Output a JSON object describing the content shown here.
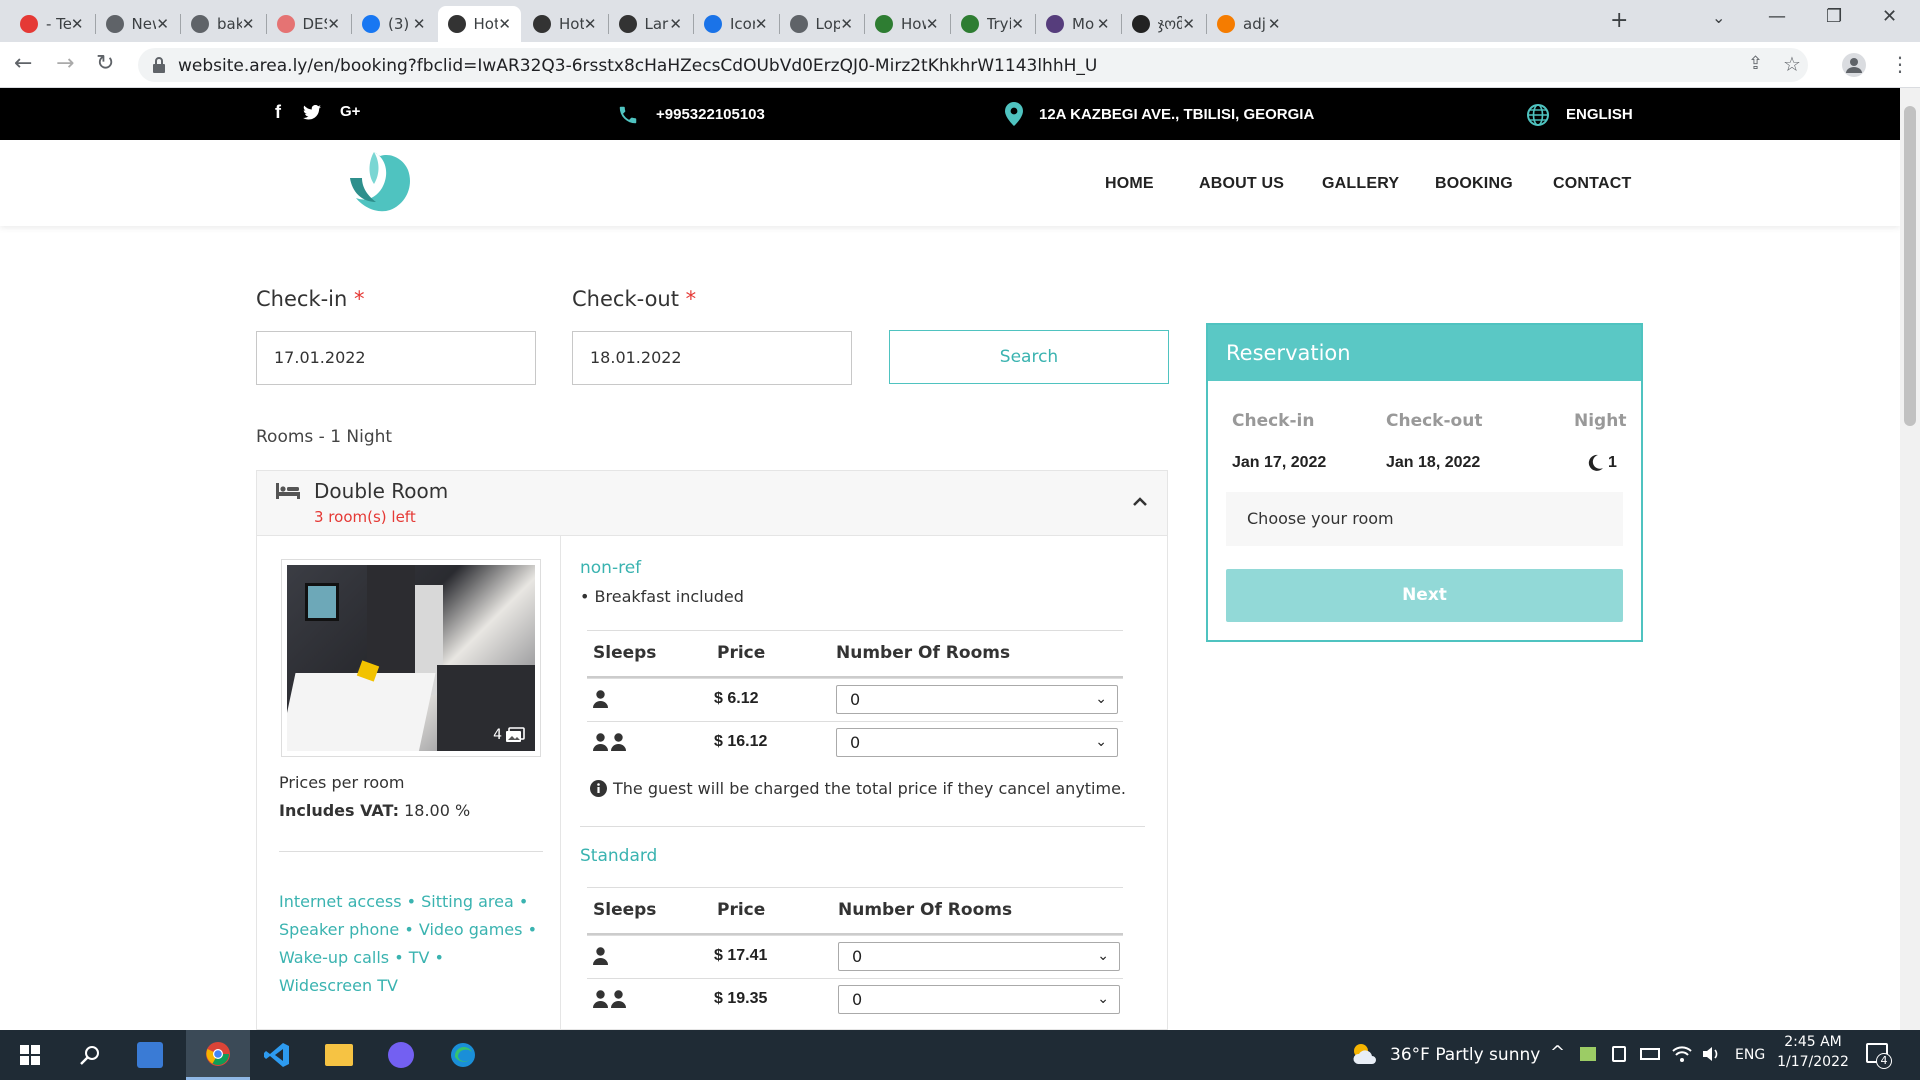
{
  "browser": {
    "tabs": [
      {
        "label": "- Te",
        "color": "#e53935"
      },
      {
        "label": "New",
        "color": "#5f6368"
      },
      {
        "label": "bak",
        "color": "#5f6368"
      },
      {
        "label": "DES",
        "color": "#e57373"
      },
      {
        "label": "(3)",
        "color": "#1877f2"
      },
      {
        "label": "Hot",
        "color": "#333333"
      },
      {
        "label": "Hot",
        "color": "#333333"
      },
      {
        "label": "Lara",
        "color": "#333333"
      },
      {
        "label": "Icor",
        "color": "#1a73e8"
      },
      {
        "label": "Lop",
        "color": "#5f6368"
      },
      {
        "label": "How",
        "color": "#2e7d32"
      },
      {
        "label": "Tryi",
        "color": "#2e7d32"
      },
      {
        "label": "Mo",
        "color": "#563d7c"
      },
      {
        "label": "ჯომ",
        "color": "#222222"
      },
      {
        "label": "adj",
        "color": "#f57c00"
      }
    ],
    "url": "website.area.ly/en/booking?fbclid=IwAR32Q3-6rsstx8cHaHZecsCdOUbVd0ErzQJ0-Mirz2tKhkhrW1143lhhH_U"
  },
  "topbar": {
    "phone": "+995322105103",
    "address": "12A KAZBEGI AVE., TBILISI, GEORGIA",
    "language": "ENGLISH"
  },
  "nav": {
    "items": [
      "HOME",
      "ABOUT US",
      "GALLERY",
      "BOOKING",
      "CONTACT"
    ]
  },
  "form": {
    "checkin_label": "Check-in",
    "checkout_label": "Check-out",
    "required_mark": "*",
    "checkin_value": "17.01.2022",
    "checkout_value": "18.01.2022",
    "search_label": "Search"
  },
  "rooms": {
    "title": "Rooms - 1 Night",
    "room": {
      "name": "Double Room",
      "left": "3 room(s) left",
      "photo_count": "4",
      "prices_per_room": "Prices per room",
      "vat_label": "Includes VAT:",
      "vat_value": "18.00 %",
      "amenities": "Internet access • Sitting area • Speaker phone • Video games • Wake-up calls • TV • Widescreen TV"
    },
    "rates": [
      {
        "title": "non-ref",
        "bullet": "Breakfast included",
        "headers": [
          "Sleeps",
          "Price",
          "Number Of Rooms"
        ],
        "rows": [
          {
            "price": "$ 6.12",
            "qty": "0"
          },
          {
            "price": "$ 16.12",
            "qty": "0"
          }
        ],
        "note": "The guest will be charged the total price if they cancel anytime."
      },
      {
        "title": "Standard",
        "headers": [
          "Sleeps",
          "Price",
          "Number Of Rooms"
        ],
        "rows": [
          {
            "price": "$ 17.41",
            "qty": "0"
          },
          {
            "price": "$ 19.35",
            "qty": "0"
          }
        ]
      }
    ]
  },
  "reservation": {
    "title": "Reservation",
    "checkin_label": "Check-in",
    "checkout_label": "Check-out",
    "night_label": "Night",
    "checkin_value": "Jan 17, 2022",
    "checkout_value": "Jan 18, 2022",
    "nights": "1",
    "choose": "Choose your room",
    "next": "Next"
  },
  "taskbar": {
    "weather": "36°F  Partly sunny",
    "lang": "ENG",
    "time": "2:45 AM",
    "date": "1/17/2022",
    "notifications": "4"
  },
  "colors": {
    "accent": "#4fc3c0",
    "accent_light": "#92d9d7",
    "danger": "#e53935"
  }
}
